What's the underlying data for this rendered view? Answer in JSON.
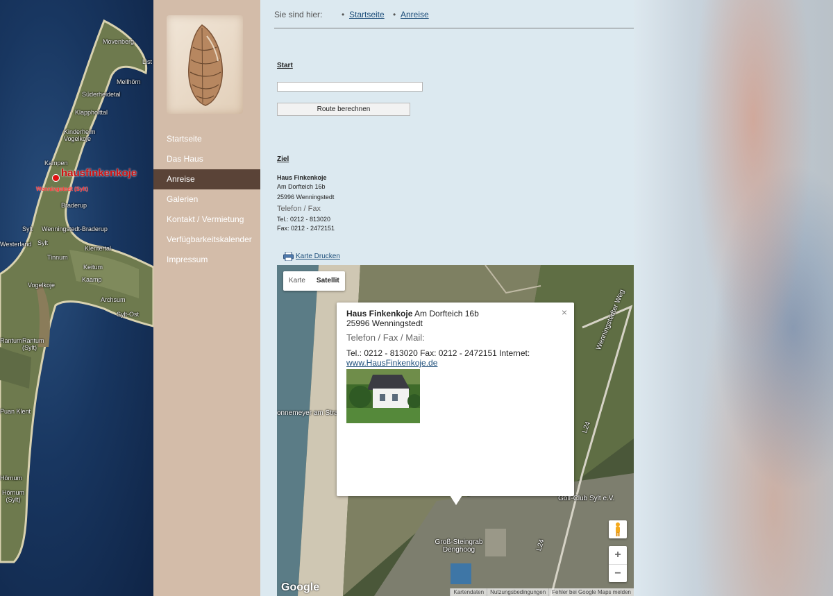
{
  "island_map": {
    "brand": "hausfinkenkoje",
    "brand_sub": "Wenningstedt (Sylt)",
    "labels": [
      "Movenberg",
      "List",
      "Mellhörn",
      "Süderheidetal",
      "Klappholttal",
      "Kinderheim Vogelkoje",
      "Kampen",
      "Braderup",
      "Sylt",
      "Wenningstedt-Braderup",
      "Westerland",
      "Sylt",
      "Klentertal",
      "Tinnum",
      "Keitum",
      "Kaamp",
      "Vogelkoje",
      "Archsum",
      "Sylt-Ost",
      "Rantum",
      "Rantum (Sylt)",
      "Puan Klent",
      "Hörnum",
      "Hörnum (Sylt)"
    ]
  },
  "sidebar": {
    "nav": [
      "Startseite",
      "Das Haus",
      "Anreise",
      "Galerien",
      "Kontakt / Vermietung",
      "Verfügbarkeitskalender",
      "Impressum"
    ],
    "active_index": 2
  },
  "breadcrumb": {
    "label": "Sie sind hier:",
    "items": [
      "Startseite",
      "Anreise"
    ]
  },
  "route": {
    "start_heading": "Start",
    "start_value": "",
    "button": "Route berechnen",
    "dest_heading": "Ziel"
  },
  "destination": {
    "name": "Haus Finkenkoje",
    "street": "Am Dorfteich 16b",
    "city": "25996 Wenningstedt",
    "contact_heading": "Telefon / Fax",
    "tel": "Tel.: 0212 - 813020",
    "fax": "Fax: 0212 - 2472151"
  },
  "print_link": "Karte Drucken",
  "map": {
    "type_options": [
      "Karte",
      "Satellit"
    ],
    "selected_type": "Satellit",
    "labels": {
      "street_1": "Wenningstedter Weg",
      "street_2": "L24",
      "street_3": "L24",
      "street_4": "onnemeyer am Strand",
      "golf": "Golf-Club Sylt e.V.",
      "grave": "Groß-Steingrab Denghoog"
    },
    "info": {
      "name": "Haus Finkenkoje",
      "street": "Am Dorfteich 16b",
      "city": "25996 Wenningstedt",
      "contact_heading": "Telefon / Fax / Mail:",
      "details": "Tel.: 0212 - 813020 Fax: 0212 - 2472151 Internet:",
      "website": "www.HausFinkenkoje.de",
      "close": "×"
    },
    "zoom_in": "+",
    "zoom_out": "−",
    "google": "Google",
    "attribution": [
      "Kartendaten",
      "Nutzungsbedingungen",
      "Fehler bei Google Maps melden"
    ]
  }
}
